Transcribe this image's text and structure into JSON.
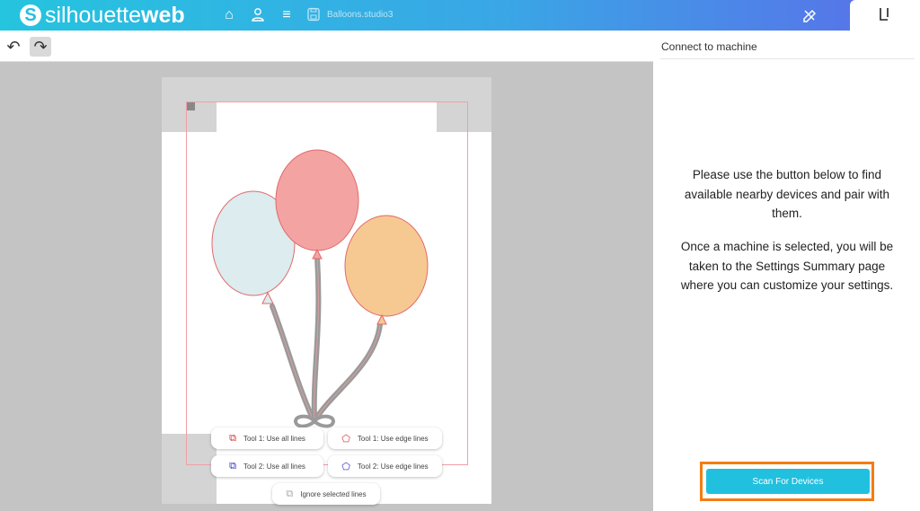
{
  "header": {
    "logo_text_1": "silhouette",
    "logo_text_2": "web",
    "file_name": "Balloons.studio3"
  },
  "toolbar": {
    "undo": "↶",
    "redo": "↷"
  },
  "canvas": {
    "buttons": [
      {
        "label": "Tool 1: Use all lines",
        "color": "#d32f2f"
      },
      {
        "label": "Tool 1: Use edge lines",
        "color": "#d32f2f"
      },
      {
        "label": "Tool 2: Use all lines",
        "color": "#2b2fc0"
      },
      {
        "label": "Tool 2: Use edge lines",
        "color": "#2b2fc0"
      },
      {
        "label": "Ignore selected lines",
        "color": "#aaaaaa"
      }
    ]
  },
  "panel": {
    "title": "Connect to machine",
    "paragraph1": "Please use the button below to find available nearby devices and pair with them.",
    "paragraph2": "Once a machine is selected, you will be taken to the Settings Summary page where you can customize your settings.",
    "scan_button": "Scan For Devices"
  }
}
